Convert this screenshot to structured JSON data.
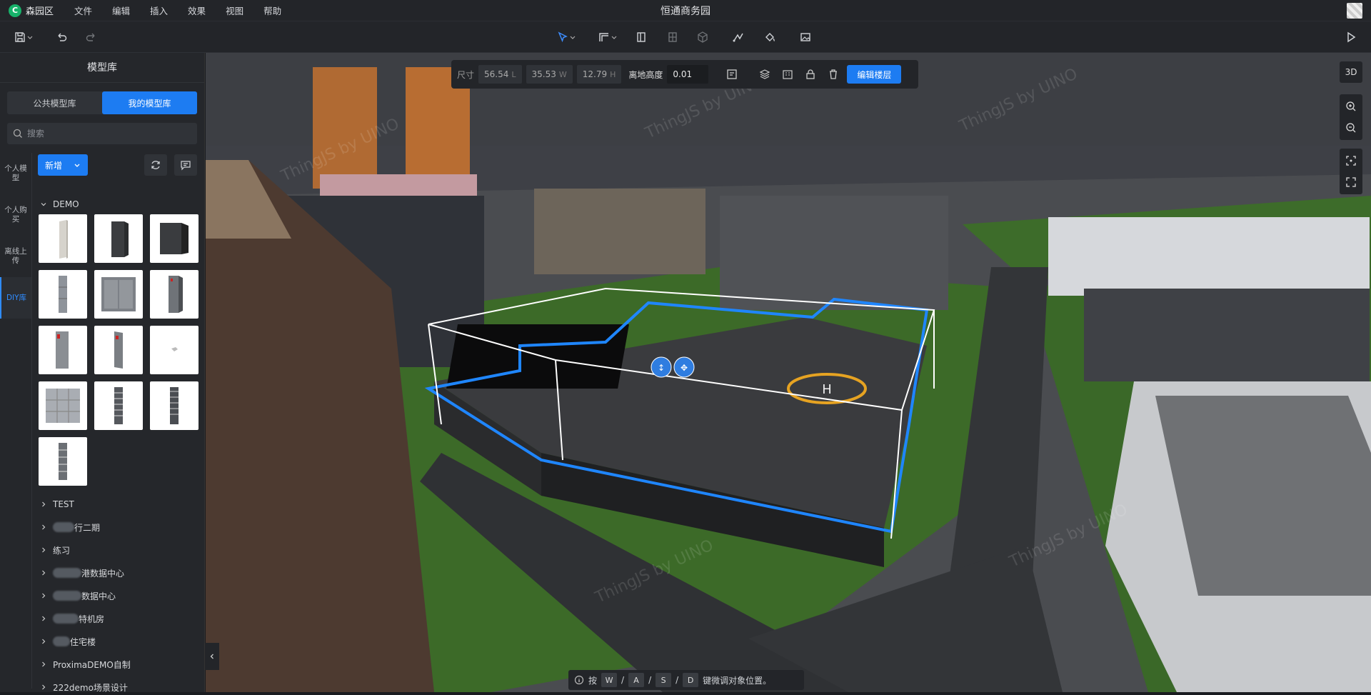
{
  "app": {
    "logo": "森园区",
    "title": "恒通商务园"
  },
  "menu": [
    "文件",
    "编辑",
    "插入",
    "效果",
    "视图",
    "帮助"
  ],
  "sidebar": {
    "title": "模型库",
    "seg": [
      "公共模型库",
      "我的模型库"
    ],
    "search_placeholder": "搜索",
    "vtabs": [
      "个人模型",
      "个人购买",
      "离线上传",
      "DIY库"
    ],
    "add_label": "新增",
    "groups": [
      {
        "label": "DEMO",
        "expanded": true
      },
      {
        "label": "TEST"
      },
      {
        "label": "行二期",
        "blurred": true
      },
      {
        "label": "练习"
      },
      {
        "label": "港数据中心",
        "blurred": true
      },
      {
        "label": "数据中心",
        "blurred": true
      },
      {
        "label": "特机房",
        "blurred": true
      },
      {
        "label": "住宅楼",
        "blurred": true
      },
      {
        "label": "ProximaDEMO自制"
      },
      {
        "label": "222demo场景设计"
      }
    ]
  },
  "floating_toolbar": {
    "size_label": "尺寸",
    "L": "56.54",
    "L_unit": "L",
    "W": "35.53",
    "W_unit": "W",
    "H": "12.79",
    "H_unit": "H",
    "elev_label": "离地高度",
    "elev_value": "0.01",
    "edit_floor": "编辑楼层"
  },
  "viewport": {
    "view_mode": "3D",
    "watermark": "ThingJS by UINO",
    "helipad_letter": "H"
  },
  "hint": {
    "prefix": "按",
    "keys": [
      "W",
      "A",
      "S",
      "D"
    ],
    "sep": "/",
    "suffix": "键微调对象位置。"
  }
}
